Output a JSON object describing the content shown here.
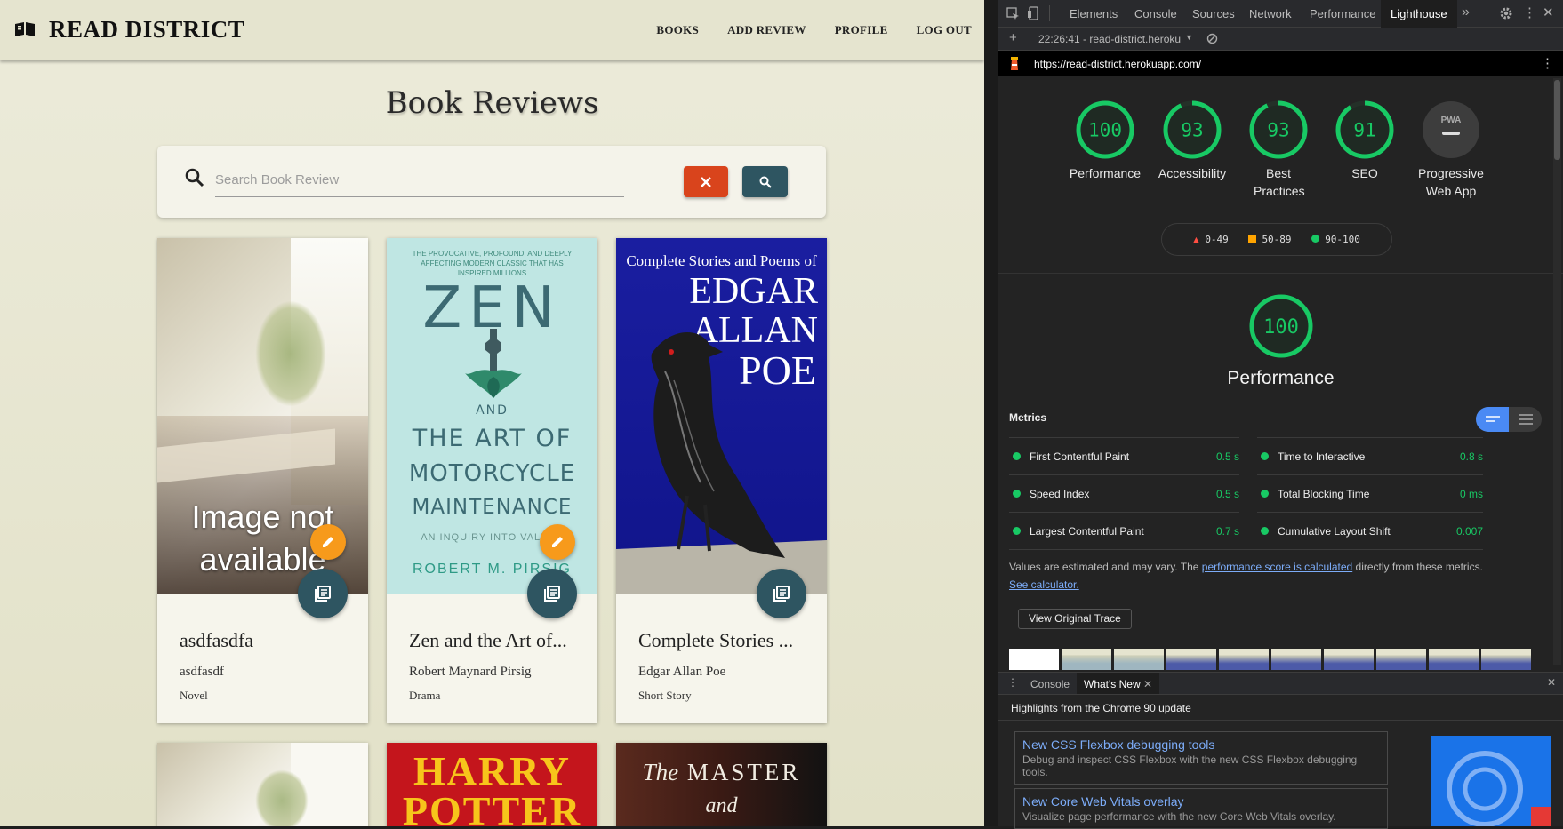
{
  "app": {
    "brand": "READ DISTRICT",
    "nav": [
      "BOOKS",
      "ADD REVIEW",
      "PROFILE",
      "LOG OUT"
    ],
    "page_title": "Book Reviews",
    "search": {
      "placeholder": "Search Book Review"
    },
    "books": [
      {
        "title": "asdfasdfa",
        "author": "asdfasdf",
        "genre": "Novel",
        "cover_text": "Image not available",
        "editable": true
      },
      {
        "title": "Zen and the Art of...",
        "author": "Robert Maynard Pirsig",
        "genre": "Drama",
        "cover": {
          "tagline": "THE PROVOCATIVE, PROFOUND, AND DEEPLY AFFECTING MODERN CLASSIC THAT HAS INSPIRED MILLIONS",
          "line1": "ZEN",
          "line2": "AND",
          "line3": "THE ART OF",
          "line4": "MOTORCYCLE",
          "line5": "MAINTENANCE",
          "sub": "AN INQUIRY INTO VALUES",
          "author": "ROBERT M. PIRSIG"
        },
        "editable": true
      },
      {
        "title": "Complete Stories ...",
        "author": "Edgar Allan Poe",
        "genre": "Short Story",
        "cover": {
          "top": "Complete Stories and Poems of",
          "line1": "EDGAR",
          "line2": "ALLAN",
          "line3": "POE"
        },
        "editable": false
      }
    ],
    "row2": [
      {
        "cover_text": ""
      },
      {
        "cover": {
          "line1": "HARRY",
          "line2": "POTTER"
        }
      },
      {
        "cover": {
          "line1": "The",
          "line2": "MASTER",
          "line3": "and"
        }
      }
    ]
  },
  "devtools": {
    "tabs": [
      "Elements",
      "Console",
      "Sources",
      "Network",
      "Performance",
      "Lighthouse"
    ],
    "active_tab": "Lighthouse",
    "report_selector": "22:26:41 - read-district.heroku",
    "url": "https://read-district.herokuapp.com/",
    "scores": [
      {
        "label": "Performance",
        "value": "100",
        "fraction": 1.0
      },
      {
        "label": "Accessibility",
        "value": "93",
        "fraction": 0.93
      },
      {
        "label": "Best Practices",
        "value": "93",
        "fraction": 0.93
      },
      {
        "label": "SEO",
        "value": "91",
        "fraction": 0.91
      },
      {
        "label": "Progressive Web App",
        "value": "PWA"
      }
    ],
    "legend": [
      "0-49",
      "50-89",
      "90-100"
    ],
    "main_score": {
      "value": "100",
      "label": "Performance"
    },
    "metrics_title": "Metrics",
    "metrics": [
      {
        "name": "First Contentful Paint",
        "value": "0.5 s"
      },
      {
        "name": "Time to Interactive",
        "value": "0.8 s"
      },
      {
        "name": "Speed Index",
        "value": "0.5 s"
      },
      {
        "name": "Total Blocking Time",
        "value": "0 ms"
      },
      {
        "name": "Largest Contentful Paint",
        "value": "0.7 s"
      },
      {
        "name": "Cumulative Layout Shift",
        "value": "0.007"
      }
    ],
    "note_pre": "Values are estimated and may vary. The ",
    "note_link": "performance score is calculated",
    "note_mid": " directly from these metrics. ",
    "note_link2": "See calculator.",
    "trace_button": "View Original Trace",
    "drawer_tabs": [
      "Console",
      "What's New"
    ],
    "drawer_heading": "Highlights from the Chrome 90 update",
    "news": [
      {
        "title": "New CSS Flexbox debugging tools",
        "desc": "Debug and inspect CSS Flexbox with the new CSS Flexbox debugging tools."
      },
      {
        "title": "New Core Web Vitals overlay",
        "desc": "Visualize page performance with the new Core Web Vitals overlay."
      }
    ],
    "colors": {
      "pass": "#18c964",
      "average": "#ffa400",
      "fail": "#ff4e42"
    }
  }
}
